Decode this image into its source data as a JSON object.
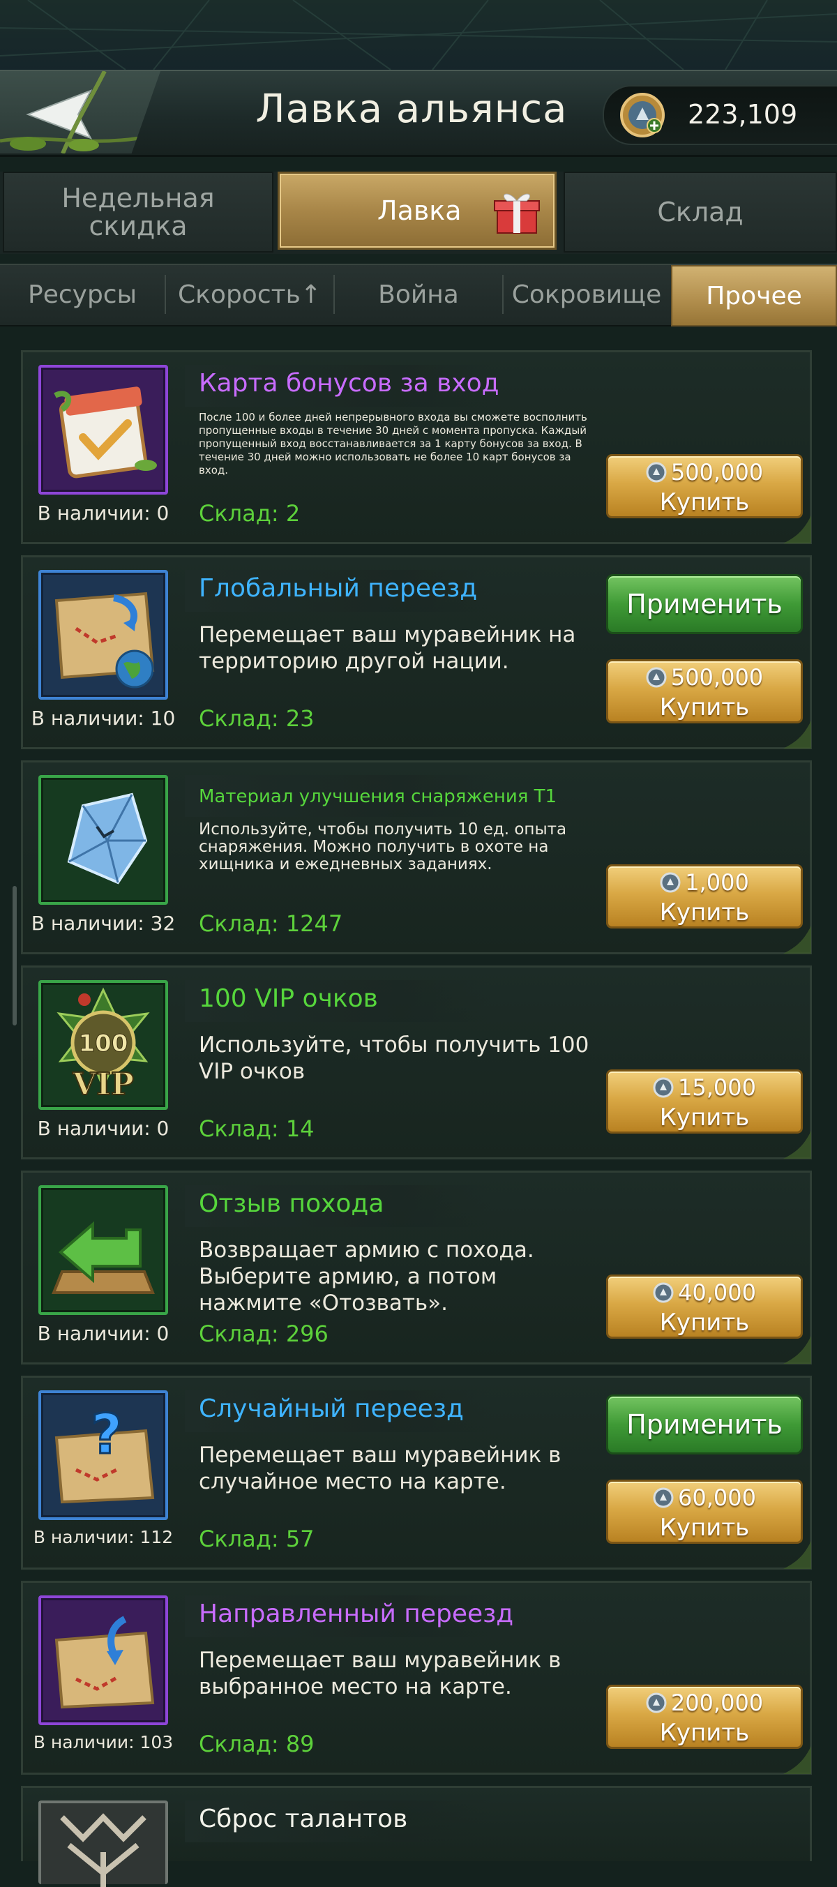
{
  "header": {
    "title": "Лавка альянса",
    "currency_value": "223,109"
  },
  "main_tabs": [
    {
      "label_line1": "Недельная",
      "label_line2": "скидка"
    },
    {
      "label": "Лавка"
    },
    {
      "label": "Склад"
    }
  ],
  "sub_tabs": [
    "Ресурсы",
    "Скорость↑",
    "Война",
    "Сокровище",
    "Прочее"
  ],
  "buy_label": "Купить",
  "apply_label": "Применить",
  "items": [
    {
      "name": "Карта бонусов за вход",
      "description": "После 100 и более дней непрерывного входа вы сможете восполнить пропущенные входы в течение 30 дней с момента пропуска. Каждый пропущенный вход восстанавливается за 1 карту бонусов за вход. В течение 30 дней можно использовать не более 10 карт бонусов за вход.",
      "in_stock": "В наличии: 0",
      "storage": "Склад: 2",
      "price": "500,000",
      "icon": "calendar-icon"
    },
    {
      "name": "Глобальный переезд",
      "description": "Перемещает ваш муравейник на территорию другой нации.",
      "in_stock": "В наличии: 10",
      "storage": "Склад: 23",
      "price": "500,000",
      "icon": "globe-map-icon"
    },
    {
      "name": "Материал улучшения снаряжения Т1",
      "description": "Используйте, чтобы получить 10 ед. опыта снаряжения. Можно получить в охоте на хищника и ежедневных заданиях.",
      "in_stock": "В наличии: 32",
      "storage": "Склад: 1247",
      "price": "1,000",
      "icon": "crystal-icon"
    },
    {
      "name": "100 VIP очков",
      "description": "Используйте, чтобы получить 100 VIP очков",
      "in_stock": "В наличии: 0",
      "storage": "Склад: 14",
      "price": "15,000",
      "icon": "vip-icon",
      "icon_text": "100",
      "icon_text2": "VIP"
    },
    {
      "name": "Отзыв похода",
      "description": "Возвращает армию с похода. Выберите армию, а потом нажмите «Отозвать».",
      "in_stock": "В наличии: 0",
      "storage": "Склад: 296",
      "price": "40,000",
      "icon": "recall-arrow-icon"
    },
    {
      "name": "Случайный переезд",
      "description": "Перемещает ваш муравейник в случайное место на карте.",
      "in_stock": "В наличии: 112",
      "storage": "Склад: 57",
      "price": "60,000",
      "icon": "random-map-icon"
    },
    {
      "name": "Направленный переезд",
      "description": "Перемещает ваш муравейник в выбранное место на карте.",
      "in_stock": "В наличии: 103",
      "storage": "Склад: 89",
      "price": "200,000",
      "icon": "directed-map-icon"
    },
    {
      "name": "Сброс талантов",
      "icon": "talent-reset-icon"
    }
  ],
  "colors": {
    "accent_gold": "#d9a845",
    "apply_green": "#3f9a36",
    "storage_green": "#5dd13b",
    "purple_name": "#c86cff",
    "blue_name": "#3fb4ff"
  }
}
